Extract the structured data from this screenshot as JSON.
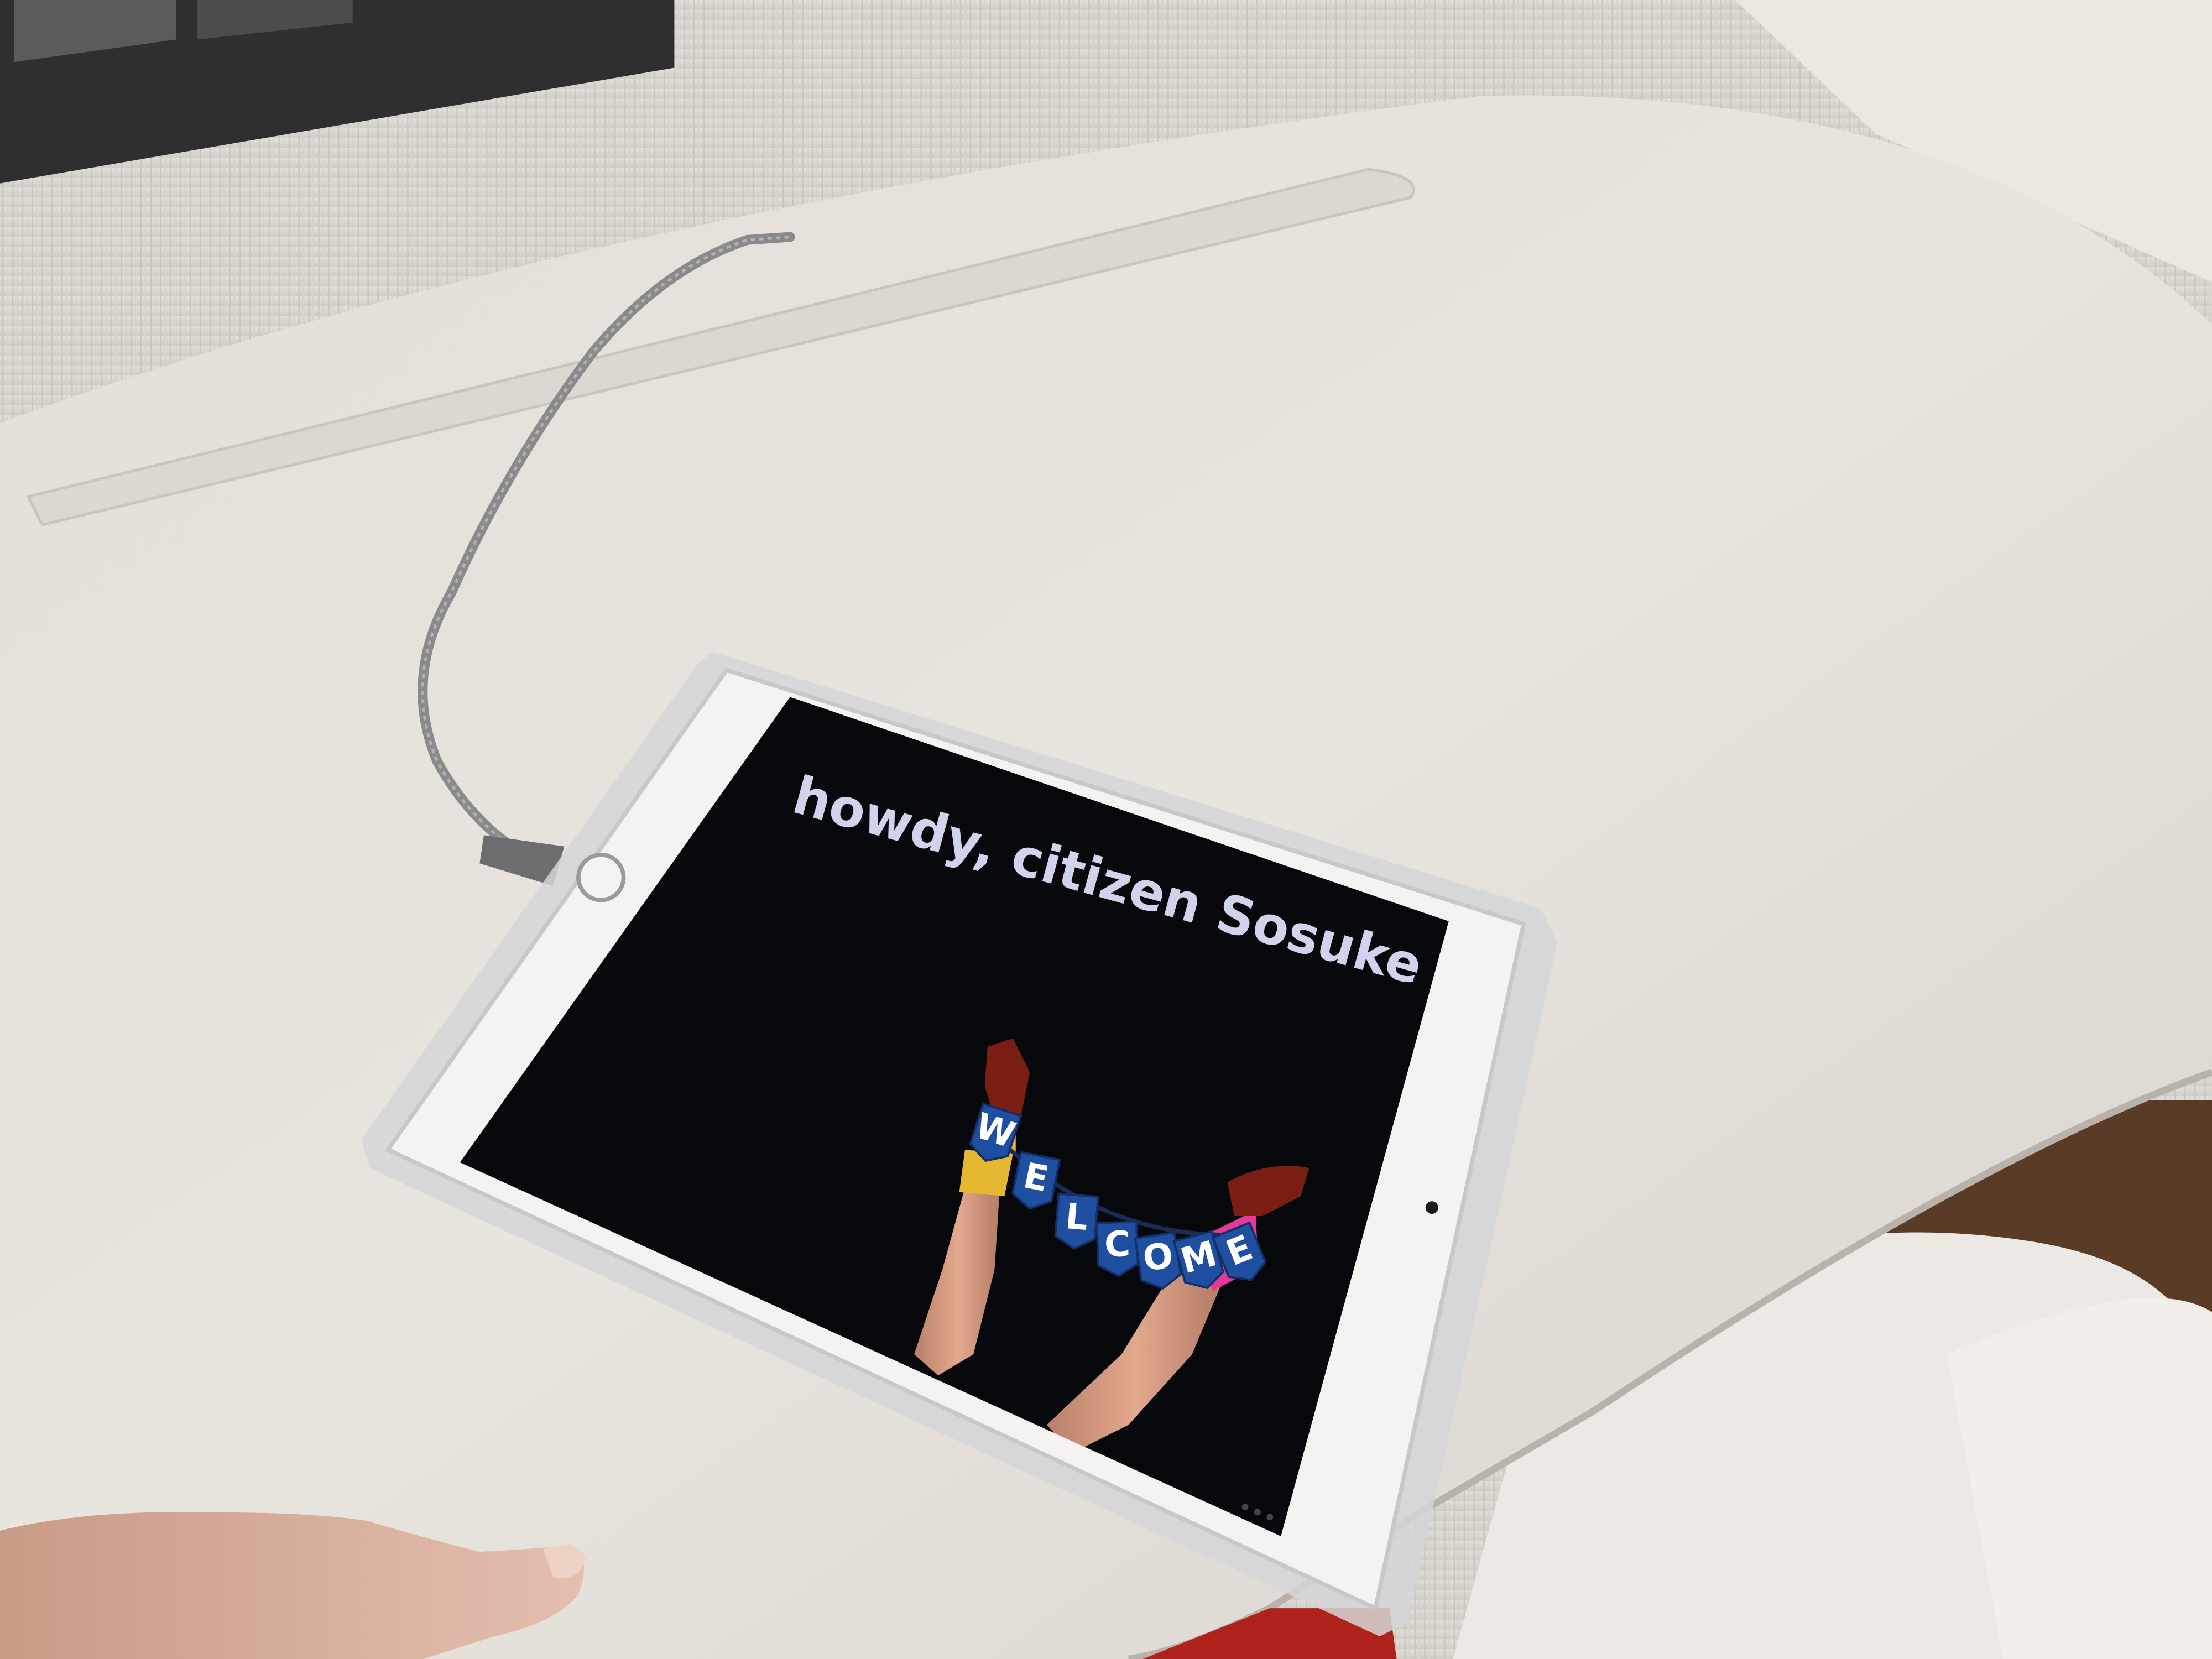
{
  "screen": {
    "greeting": "howdy, citizen Sosuke",
    "banner_letters": [
      "W",
      "E",
      "L",
      "C",
      "O",
      "M",
      "E"
    ]
  },
  "colors": {
    "desk_surface": "#e6e2dc",
    "wall_panel": "#dedcd6",
    "screen_background": "#07080b",
    "greeting_text": "#cfd3ec",
    "banner_flag": "#1f4fa0",
    "sock_yellow": "#e6b832",
    "sock_pink": "#e23a9a",
    "shoe_red": "#7a1e14",
    "tablet_frame": "#f4f3f1",
    "cable": "#8a8a8a"
  },
  "icons": [
    "home-button-icon",
    "camera-icon",
    "charging-cable-icon"
  ]
}
